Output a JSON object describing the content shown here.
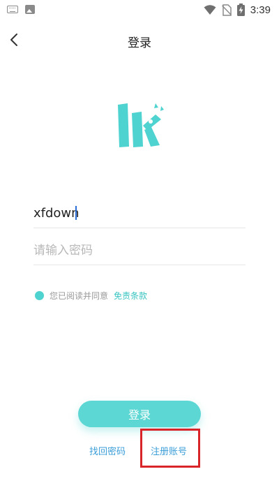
{
  "status_bar": {
    "time": "3:39"
  },
  "header": {
    "title": "登录"
  },
  "form": {
    "username_value": "xfdown",
    "password_placeholder": "请输入密码"
  },
  "agreement": {
    "text": "您已阅读并同意",
    "terms_label": "免责条款"
  },
  "buttons": {
    "login_label": "登录"
  },
  "links": {
    "forgot_password": "找回密码",
    "register": "注册账号"
  },
  "colors": {
    "accent": "#5dd7d4",
    "link": "#3b9ed8",
    "highlight": "#d9252a"
  }
}
